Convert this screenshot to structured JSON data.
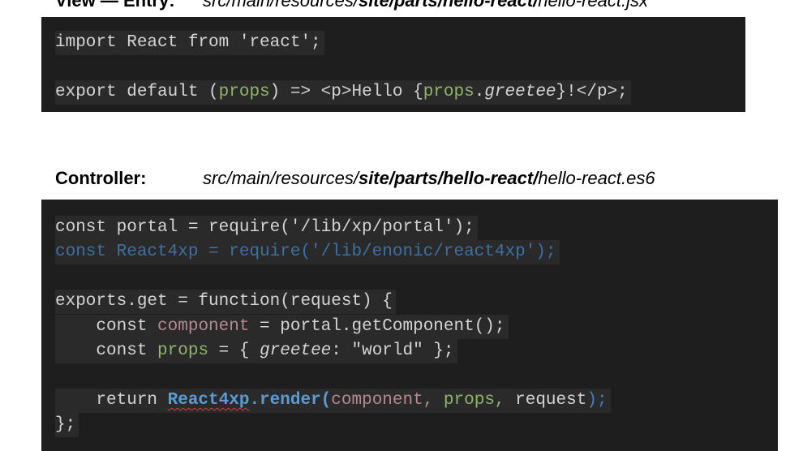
{
  "view_heading": {
    "label": "View — Entry:",
    "path_prefix": "src/main/resources/",
    "path_bold": "site/parts/hello-react/",
    "path_file": "hello-react.jsx"
  },
  "view_code": {
    "line1": "import React from 'react';",
    "line2_a": "export default (",
    "line2_props1": "props",
    "line2_b": ") => <p>Hello {",
    "line2_props2": "props",
    "line2_dot": ".",
    "line2_greetee": "greetee",
    "line2_c": "}!</p>;"
  },
  "controller_heading": {
    "label": "Controller:",
    "path_prefix": "src/main/resources/",
    "path_bold": "site/parts/hello-react/",
    "path_file": "hello-react.es6"
  },
  "controller_code": {
    "line1": "const portal = require('/lib/xp/portal');",
    "line2": "const React4xp = require('/lib/enonic/react4xp');",
    "line3": "exports.get = function(request) {",
    "line4_a": "    const ",
    "line4_component": "component",
    "line4_b": " = portal.getComponent();",
    "line5_a": "    const ",
    "line5_props": "props",
    "line5_b": " = { ",
    "line5_greetee": "greetee",
    "line5_c": ": \"world\" };",
    "line6_a": "    return ",
    "line6_react4xp": "React4xp",
    "line6_render": ".render(",
    "line6_component": "component, ",
    "line6_props": "props, ",
    "line6_request": "request",
    "line6_end": ");",
    "line7": "};"
  }
}
